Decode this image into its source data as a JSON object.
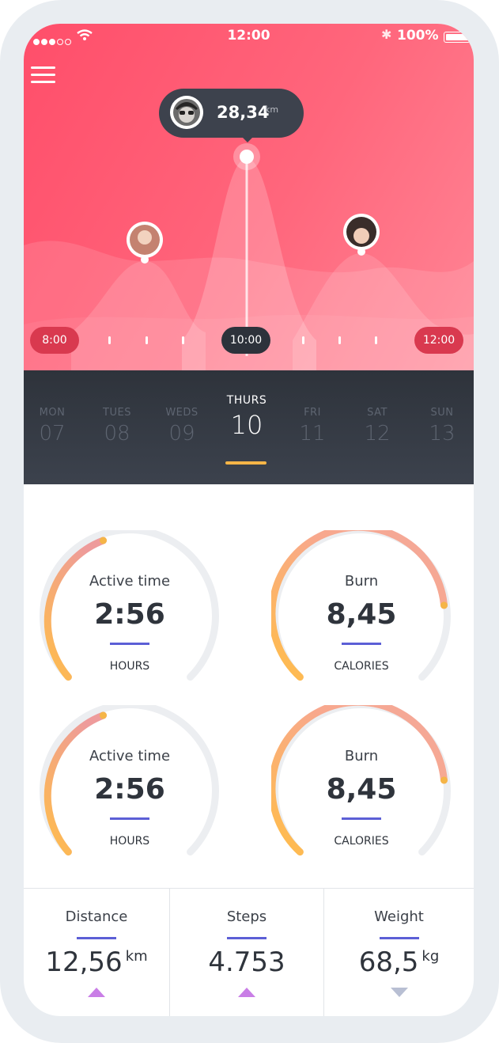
{
  "status_bar": {
    "time": "12:00",
    "battery": "100%"
  },
  "tracker": {
    "bubble_value": "28,34",
    "bubble_unit": "km",
    "time_start": "8:00",
    "time_current": "10:00",
    "time_end": "12:00"
  },
  "days": [
    {
      "name": "MON",
      "date": "07"
    },
    {
      "name": "TUES",
      "date": "08"
    },
    {
      "name": "WEDS",
      "date": "09"
    },
    {
      "name": "THURS",
      "date": "10"
    },
    {
      "name": "FRI",
      "date": "11"
    },
    {
      "name": "SAT",
      "date": "12"
    },
    {
      "name": "SUN",
      "date": "13"
    }
  ],
  "gauges": [
    {
      "title": "Active time",
      "value": "2:56",
      "unit": "HOURS"
    },
    {
      "title": "Burn",
      "value": "8,45",
      "unit": "CALORIES"
    },
    {
      "title": "Active time",
      "value": "2:56",
      "unit": "HOURS"
    },
    {
      "title": "Burn",
      "value": "8,45",
      "unit": "CALORIES"
    }
  ],
  "stats": {
    "distance": {
      "label": "Distance",
      "value": "12,56",
      "unit": "km",
      "trend": "up"
    },
    "steps": {
      "label": "Steps",
      "value": "4.753",
      "trend": "up"
    },
    "weight": {
      "label": "Weight",
      "value": "68,5",
      "unit": "kg",
      "trend": "down"
    }
  },
  "colors": {
    "hero_accent": "#ff5a70",
    "dark_panel": "#373c46",
    "selected_day": "#f5b547",
    "underline": "#5c5fd6",
    "trend_up": "#c97ee6",
    "trend_down": "#b8bfd3"
  }
}
